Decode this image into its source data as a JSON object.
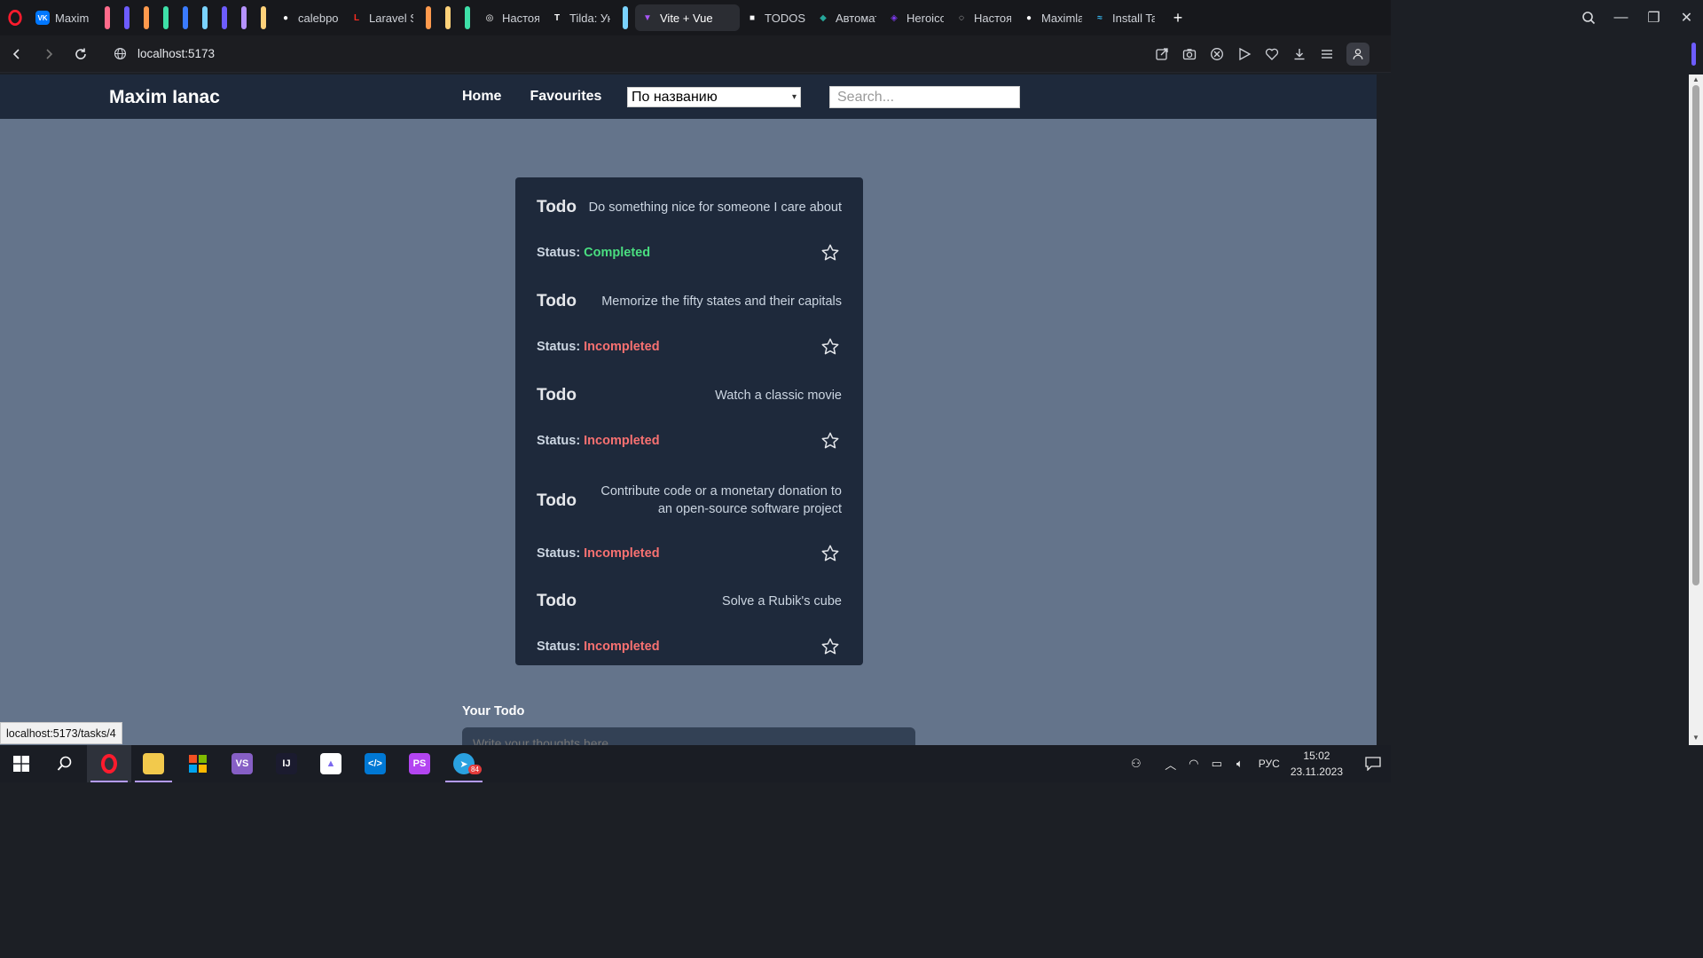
{
  "browser": {
    "tabs": [
      {
        "label": "Maxim Ya",
        "icon": "vk-icon",
        "color": "#0077ff"
      },
      {
        "label": "calebporz",
        "icon": "github-icon",
        "color": "#ffffff"
      },
      {
        "label": "Laravel Sc",
        "icon": "laravel-icon",
        "color": "#ff2d20"
      },
      {
        "label": "Настоящ",
        "icon": "circle-icon",
        "color": "#ffffff"
      },
      {
        "label": "Tilda: Уни",
        "icon": "tilda-icon",
        "color": "#ffffff"
      },
      {
        "label": "Vite + Vue",
        "icon": "vite-icon",
        "color": "#a855f7",
        "active": true
      },
      {
        "label": "TODOS -",
        "icon": "dark-box-icon",
        "color": "#ffffff"
      },
      {
        "label": "Автомати",
        "icon": "cube-icon",
        "color": "#26a69a"
      },
      {
        "label": "Heroicon",
        "icon": "shield-icon",
        "color": "#7c3aed"
      },
      {
        "label": "Настоящ",
        "icon": "chatgpt-icon",
        "color": "#ffffff"
      },
      {
        "label": "Maximlan",
        "icon": "github-icon",
        "color": "#ffffff"
      },
      {
        "label": "Install Tai",
        "icon": "tailwind-icon",
        "color": "#38bdf8"
      }
    ],
    "pinned_pills_a": [
      "#ff6b8b",
      "#6d5cff",
      "#ff9a4d",
      "#3ee0a8",
      "#3a7bff",
      "#7ad3ff",
      "#6d5cff",
      "#b693ff",
      "#ffd27a"
    ],
    "pinned_pills_b": [
      "#ff9a4d",
      "#ffd27a",
      "#3ee0a8"
    ],
    "pinned_pills_c": [
      "#7ad3ff"
    ],
    "url": "localhost:5173",
    "status_link": "localhost:5173/tasks/4"
  },
  "app": {
    "brand": "Maxim Ianac",
    "nav": {
      "home": "Home",
      "favourites": "Favourites"
    },
    "sort_select": "По названию",
    "search_placeholder": "Search...",
    "todos": [
      {
        "title": "Todo",
        "description": "Do something nice for someone I care about",
        "status_label": "Status:",
        "status": "Completed",
        "completed": true
      },
      {
        "title": "Todo",
        "description": "Memorize the fifty states and their capitals",
        "status_label": "Status:",
        "status": "Incompleted",
        "completed": false
      },
      {
        "title": "Todo",
        "description": "Watch a classic movie",
        "status_label": "Status:",
        "status": "Incompleted",
        "completed": false
      },
      {
        "title": "Todo",
        "description": "Contribute code or a monetary donation to an open-source software project",
        "status_label": "Status:",
        "status": "Incompleted",
        "completed": false
      },
      {
        "title": "Todo",
        "description": "Solve a Rubik's cube",
        "status_label": "Status:",
        "status": "Incompleted",
        "completed": false
      }
    ],
    "your_todo_label": "Your Todo",
    "your_todo_placeholder": "Write your thoughts here..."
  },
  "taskbar": {
    "apps": [
      "opera-icon",
      "file-explorer-icon",
      "microsoft-store-icon",
      "visual-studio-icon",
      "intellij-icon",
      "clickup-icon",
      "vscode-icon",
      "phpstorm-icon",
      "telegram-icon"
    ],
    "telegram_badge": "84",
    "language": "РУС",
    "time": "15:02",
    "date": "23.11.2023"
  }
}
